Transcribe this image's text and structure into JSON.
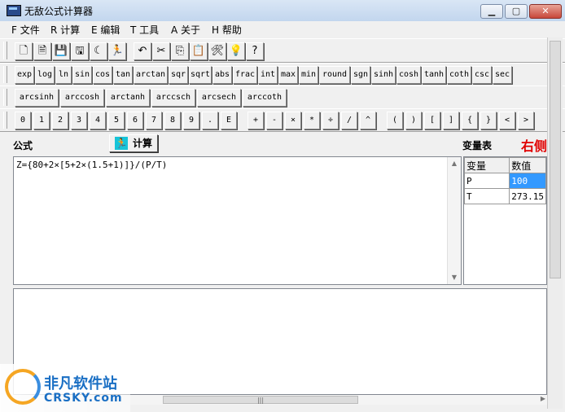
{
  "window": {
    "title": "无敌公式计算器",
    "minimize": "▁",
    "maximize": "▢",
    "close": "✕"
  },
  "menu": [
    "F 文件",
    "R 计算",
    "E 编辑",
    "T 工具",
    "A 关于",
    "H 帮助"
  ],
  "toolbar_icons": [
    {
      "name": "new-file-icon",
      "glyph": "🗋"
    },
    {
      "name": "new-doc-icon",
      "glyph": "🗎"
    },
    {
      "name": "save-icon",
      "glyph": "💾"
    },
    {
      "name": "save-as-icon",
      "glyph": "🖫"
    },
    {
      "name": "moon-icon",
      "glyph": "☾"
    },
    {
      "name": "run-icon",
      "glyph": "🏃"
    },
    {
      "name": "undo-icon",
      "glyph": "↶"
    },
    {
      "name": "cut-icon",
      "glyph": "✂"
    },
    {
      "name": "copy-icon",
      "glyph": "⎘"
    },
    {
      "name": "paste-icon",
      "glyph": "📋"
    },
    {
      "name": "tools-icon",
      "glyph": "🛠"
    },
    {
      "name": "bulb-icon",
      "glyph": "💡"
    },
    {
      "name": "help-icon",
      "glyph": "?"
    }
  ],
  "functions": [
    "exp",
    "log",
    "ln",
    "sin",
    "cos",
    "tan",
    "arctan",
    "sqr",
    "sqrt",
    "abs",
    "frac",
    "int",
    "max",
    "min",
    "round",
    "sgn",
    "sinh",
    "cosh",
    "tanh",
    "coth",
    "csc",
    "sec"
  ],
  "functions2": [
    "arcsinh",
    "arccosh",
    "arctanh",
    "arccsch",
    "arcsech",
    "arccoth"
  ],
  "keys": [
    "0",
    "1",
    "2",
    "3",
    "4",
    "5",
    "6",
    "7",
    "8",
    "9",
    ".",
    "E",
    "+",
    "-",
    "×",
    "*",
    "÷",
    "/",
    "^",
    "(",
    ")",
    "[",
    "]",
    "{",
    "}",
    "<",
    ">"
  ],
  "formula_label": "公式",
  "calc_button": "计算",
  "vars_label": "变量表",
  "right_side": "右侧",
  "formula": "Z={80+2×[5+2×(1.5+1)]}/(P/T)",
  "var_table": {
    "headers": [
      "变量",
      "数值"
    ],
    "rows": [
      [
        "P",
        "100"
      ],
      [
        "T",
        "273.15"
      ]
    ]
  },
  "watermark": {
    "cn": "非凡软件站",
    "en": "CRSKY.com"
  },
  "colors": {
    "accent_red": "#e00000",
    "selected_cell": "#3399ff",
    "calc_icon": "#16c4d8"
  }
}
